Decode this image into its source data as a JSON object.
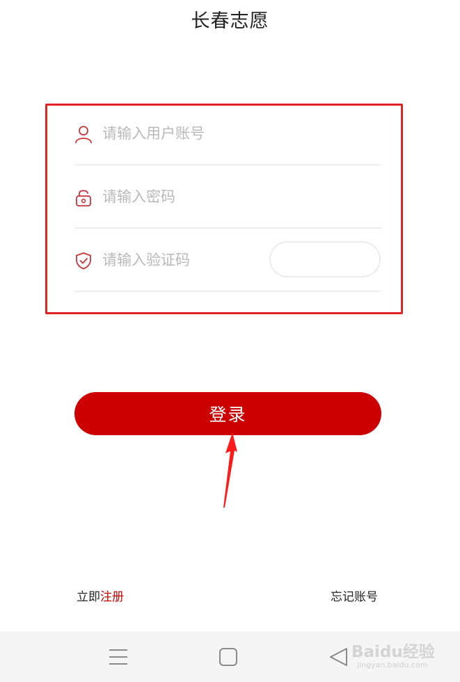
{
  "header": {
    "title": "长春志愿"
  },
  "form": {
    "username": {
      "icon": "user-icon",
      "placeholder": "请输入用户账号",
      "value": ""
    },
    "password": {
      "icon": "lock-icon",
      "placeholder": "请输入密码",
      "value": ""
    },
    "captcha": {
      "icon": "shield-check-icon",
      "placeholder": "请输入验证码",
      "value": ""
    }
  },
  "login_button": {
    "label": "登录"
  },
  "footer": {
    "register_prefix": "立即",
    "register_link": "注册",
    "forgot_account": "忘记账号"
  },
  "watermark": {
    "logo": "Baidu经验",
    "url": "jingyan.baidu.com"
  },
  "colors": {
    "brand_red": "#cc0000",
    "annotation_red": "#e02424",
    "icon_red": "#c9333a",
    "placeholder_gray": "#b9b9b9"
  }
}
